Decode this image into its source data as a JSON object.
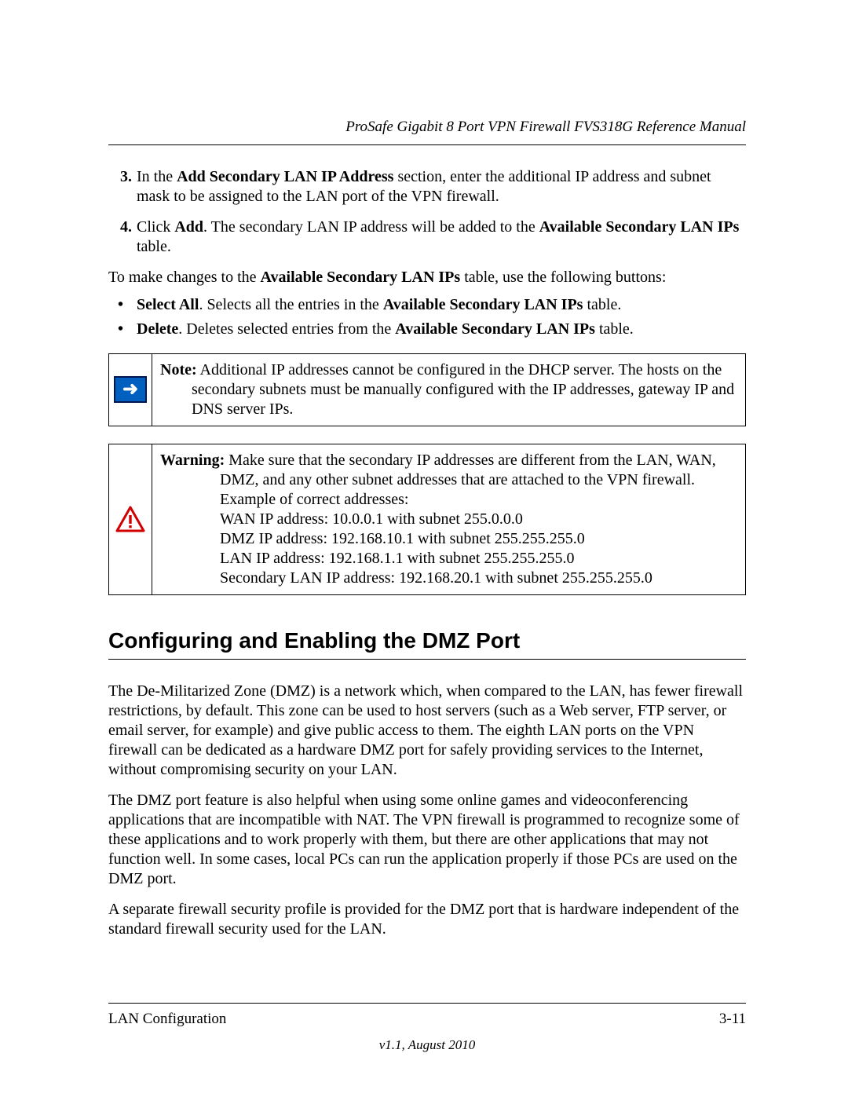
{
  "header": {
    "title": "ProSafe Gigabit 8 Port VPN Firewall FVS318G Reference Manual"
  },
  "steps": {
    "s3_pre": "In the ",
    "s3_b1": "Add Secondary LAN IP Address",
    "s3_post": " section, enter the additional IP address and subnet mask to be assigned to the LAN port of the VPN firewall.",
    "s4_pre": "Click ",
    "s4_b1": "Add",
    "s4_mid": ". The secondary LAN IP address will be added to the ",
    "s4_b2": "Available Secondary LAN IPs",
    "s4_post": " table."
  },
  "intro": {
    "pre": "To make changes to the ",
    "b1": "Available Secondary LAN IPs",
    "post": " table, use the following buttons:"
  },
  "bullets": {
    "b1_b": "Select All",
    "b1_mid": ". Selects all the entries in the ",
    "b1_b2": "Available Secondary LAN IPs",
    "b1_post": " table.",
    "b2_b": "Delete",
    "b2_mid": ". Deletes selected entries from the ",
    "b2_b2": "Available Secondary LAN IPs",
    "b2_post": " table."
  },
  "note": {
    "label": "Note:",
    "text": " Additional IP addresses cannot be configured in the DHCP server. The hosts on the secondary subnets must be manually configured with the IP addresses, gateway IP and DNS server IPs."
  },
  "warning": {
    "label": "Warning:",
    "lead": " Make sure that the secondary IP addresses are different from the LAN, WAN, DMZ, and any other subnet addresses that are attached to the VPN firewall.",
    "ex_head": "Example of correct addresses:",
    "l1": "WAN IP address: 10.0.0.1 with subnet 255.0.0.0",
    "l2": "DMZ IP address: 192.168.10.1 with subnet 255.255.255.0",
    "l3": "LAN IP address: 192.168.1.1 with subnet 255.255.255.0",
    "l4": "Secondary LAN IP address: 192.168.20.1 with subnet 255.255.255.0"
  },
  "section": {
    "title": "Configuring and Enabling the DMZ Port",
    "p1": "The De-Militarized Zone (DMZ) is a network which, when compared to the LAN, has fewer firewall restrictions, by default. This zone can be used to host servers (such as a Web server, FTP server, or email server, for example) and give public access to them. The eighth LAN ports on the VPN firewall can be dedicated as a hardware DMZ port for safely providing services to the Internet, without compromising security on your LAN.",
    "p2": "The DMZ port feature is also helpful when using some online games and videoconferencing applications that are incompatible with NAT. The VPN firewall is programmed to recognize some of these applications and to work properly with them, but there are other applications that may not function well. In some cases, local PCs can run the application properly if those PCs are used on the DMZ port.",
    "p3": "A separate firewall security profile is provided for the DMZ port that is hardware independent of the standard firewall security used for the LAN."
  },
  "footer": {
    "left": "LAN Configuration",
    "right": "3-11",
    "version": "v1.1, August 2010"
  }
}
